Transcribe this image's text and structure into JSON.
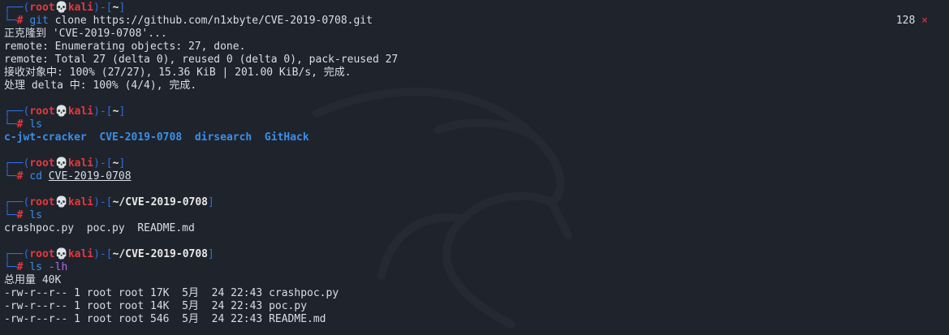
{
  "theme": {
    "background": "#1f232b",
    "prompt_frame": "#2e6fe0",
    "user_color": "#e8373f",
    "command_color": "#3b8eea",
    "flag_color": "#b06cf2",
    "text_color": "#d8dee9"
  },
  "status": {
    "exit_code": "128",
    "error_mark": "×"
  },
  "prompt": {
    "user": "root",
    "skull": "💀",
    "host": "kali",
    "hash": "#"
  },
  "blocks": [
    {
      "cwd": "~",
      "command": "git",
      "args": "clone https://github.com/n1xbyte/CVE-2019-0708.git",
      "output": [
        "正克隆到 'CVE-2019-0708'...",
        "remote: Enumerating objects: 27, done.",
        "remote: Total 27 (delta 0), reused 0 (delta 0), pack-reused 27",
        "接收对象中: 100% (27/27), 15.36 KiB | 201.00 KiB/s, 完成.",
        "处理 delta 中: 100% (4/4), 完成."
      ]
    },
    {
      "cwd": "~",
      "command": "ls",
      "dirs": [
        "c-jwt-cracker",
        "CVE-2019-0708",
        "dirsearch",
        "GitHack"
      ]
    },
    {
      "cwd": "~",
      "command": "cd",
      "args": "CVE-2019-0708"
    },
    {
      "cwd": "~/CVE-2019-0708",
      "command": "ls",
      "output": [
        "crashpoc.py  poc.py  README.md"
      ]
    },
    {
      "cwd": "~/CVE-2019-0708",
      "command": "ls",
      "flags": "-lh",
      "output": [
        "总用量 40K",
        "-rw-r--r-- 1 root root 17K  5月  24 22:43 crashpoc.py",
        "-rw-r--r-- 1 root root 14K  5月  24 22:43 poc.py",
        "-rw-r--r-- 1 root root 546  5月  24 22:43 README.md"
      ]
    }
  ]
}
